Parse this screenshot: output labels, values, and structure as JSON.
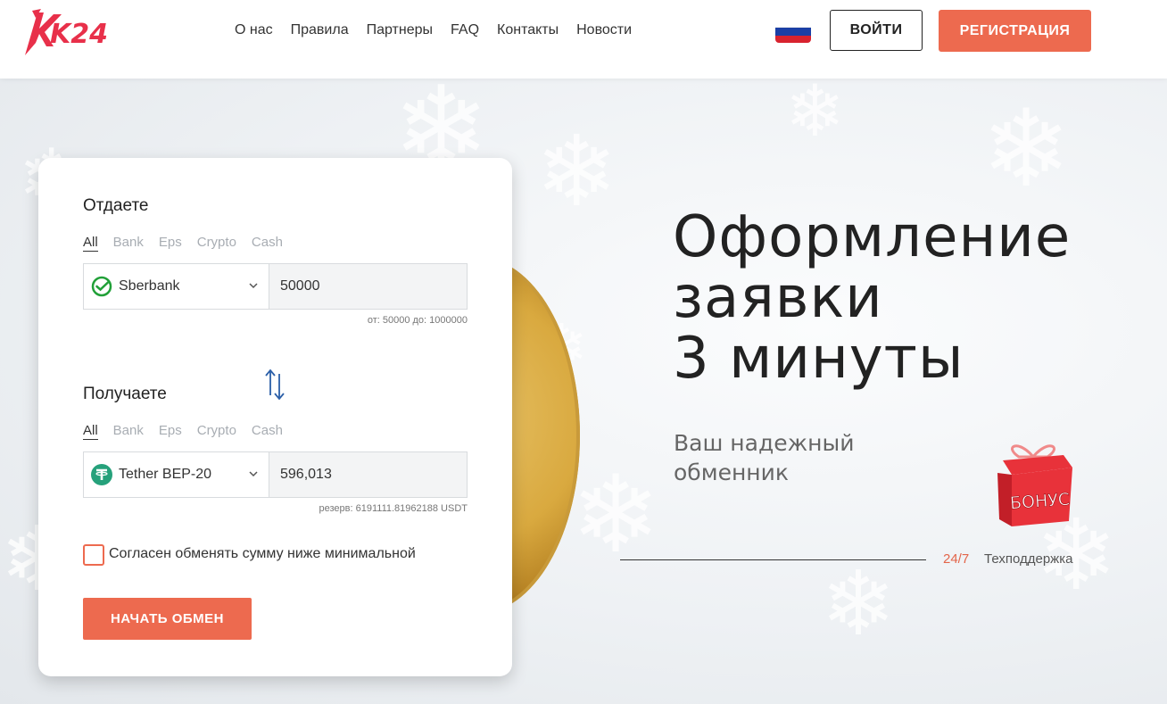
{
  "header": {
    "logo_text": "K24",
    "nav": [
      "О нас",
      "Правила",
      "Партнеры",
      "FAQ",
      "Контакты",
      "Новости"
    ],
    "language_flag": "ru-flag",
    "login_label": "ВОЙТИ",
    "register_label": "РЕГИСТРАЦИЯ"
  },
  "exchange": {
    "give": {
      "title": "Отдаете",
      "tabs": [
        "All",
        "Bank",
        "Eps",
        "Crypto",
        "Cash"
      ],
      "active_tab": "All",
      "currency": "Sberbank",
      "currency_icon": "sberbank-icon",
      "amount": "50000",
      "limits": "от: 50000 до: 1000000"
    },
    "receive": {
      "title": "Получаете",
      "tabs": [
        "All",
        "Bank",
        "Eps",
        "Crypto",
        "Cash"
      ],
      "active_tab": "All",
      "currency": "Tether BEP-20",
      "currency_icon": "tether-icon",
      "amount": "596,013",
      "reserve": "резерв: 6191111.81962188 USDT"
    },
    "agree_label": "Согласен обменять сумму ниже минимальной",
    "agree_checked": false,
    "start_label": "НАЧАТЬ ОБМЕН"
  },
  "hero": {
    "headline": [
      "Оформление",
      "заявки",
      "3 минуты"
    ],
    "subheadline": [
      "Ваш надежный",
      "обменник"
    ],
    "bonus_label": "БОНУС",
    "support_hours": "24/7",
    "support_label": "Техподдержка"
  },
  "colors": {
    "accent": "#ed6a4f",
    "sberbank": "#21a038",
    "tether": "#26a17b",
    "swap_arrows": "#2b5fa8"
  }
}
